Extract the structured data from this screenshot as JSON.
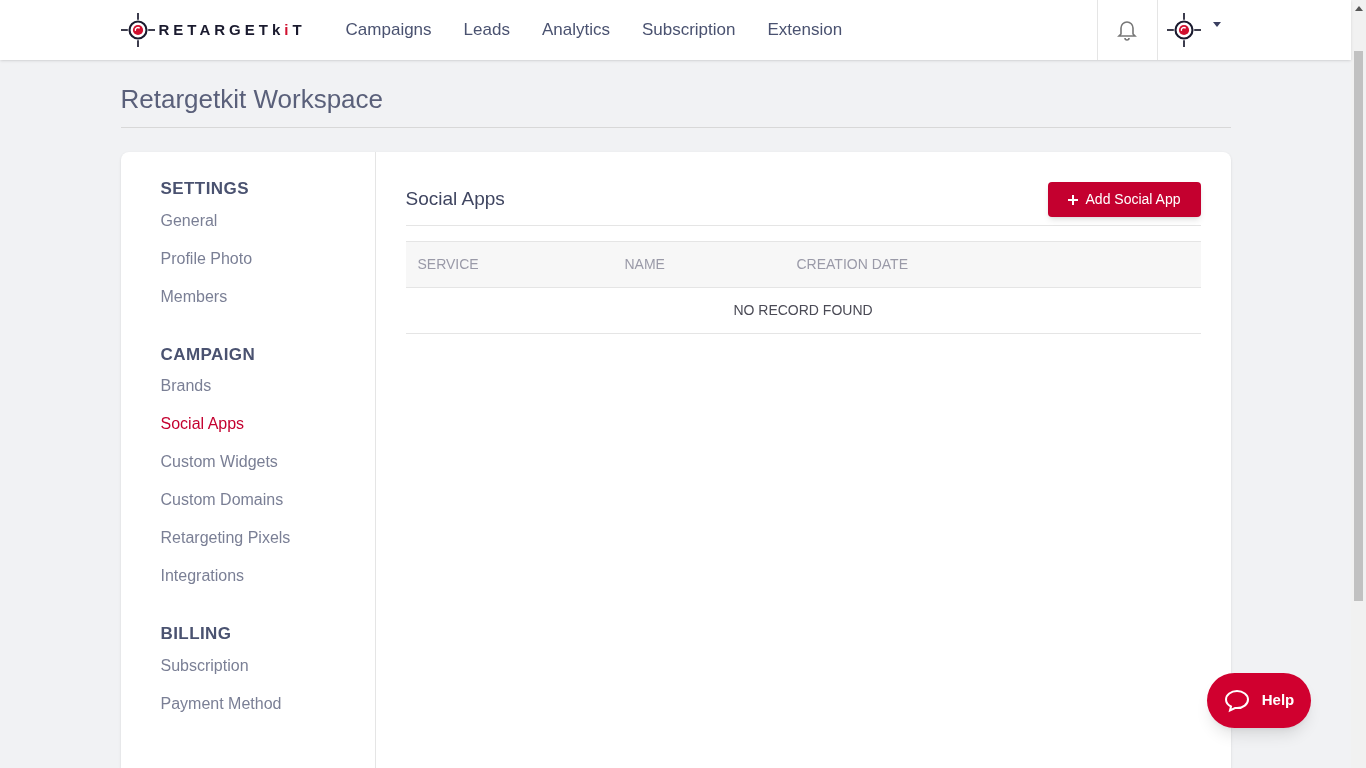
{
  "logo": [
    {
      "text": "RETARGETk",
      "accent": false
    },
    {
      "text": "i",
      "accent": true
    },
    {
      "text": "T",
      "accent": false
    }
  ],
  "nav": [
    {
      "label": "Campaigns",
      "selected": false
    },
    {
      "label": "Leads",
      "selected": false
    },
    {
      "label": "Analytics",
      "selected": false
    },
    {
      "label": "Subscription",
      "selected": false
    },
    {
      "label": "Extension",
      "selected": false
    }
  ],
  "page_title": "Retargetkit Workspace",
  "sidebar": [
    {
      "heading": "SETTINGS",
      "items": [
        {
          "label": "General",
          "selected": false
        },
        {
          "label": "Profile Photo",
          "selected": false
        },
        {
          "label": "Members",
          "selected": false
        }
      ]
    },
    {
      "heading": "CAMPAIGN",
      "items": [
        {
          "label": "Brands",
          "selected": false
        },
        {
          "label": "Social Apps",
          "selected": true
        },
        {
          "label": "Custom Widgets",
          "selected": false
        },
        {
          "label": "Custom Domains",
          "selected": false
        },
        {
          "label": "Retargeting Pixels",
          "selected": false
        },
        {
          "label": "Integrations",
          "selected": false
        }
      ]
    },
    {
      "heading": "BILLING",
      "items": [
        {
          "label": "Subscription",
          "selected": false
        },
        {
          "label": "Payment Method",
          "selected": false
        }
      ]
    }
  ],
  "panel": {
    "title": "Social Apps",
    "add_button": "Add Social App",
    "columns": [
      "SERVICE",
      "NAME",
      "CREATION DATE"
    ],
    "empty": "NO RECORD FOUND"
  },
  "help_button": "Help"
}
